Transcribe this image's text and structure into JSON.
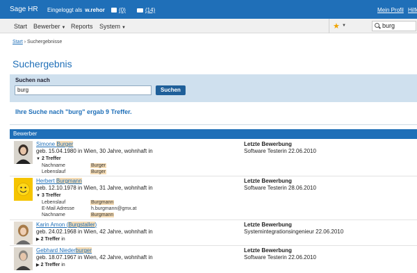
{
  "topbar": {
    "brand": "Sage HR",
    "logged_in_label": "Eingeloggt als",
    "user": "w.rehor",
    "tasks_label": "(0)",
    "messages_label": "(14)",
    "profile_link": "Mein Profil",
    "help_link": "Hilfe"
  },
  "nav": {
    "items": [
      "Start",
      "Bewerber",
      "Reports",
      "System"
    ],
    "search_value": "burg"
  },
  "breadcrumb": {
    "home": "Start",
    "separator": "›",
    "current": "Suchergebnisse"
  },
  "page_title": "Suchergebnis",
  "search": {
    "label": "Suchen nach",
    "value": "burg",
    "button": "Suchen"
  },
  "result_summary": "Ihre Suche nach \"burg\" ergab 9 Treffer.",
  "section_title": "Bewerber",
  "results": [
    {
      "name_pre": "Simone ",
      "name_hl": "Burger",
      "name_post": "",
      "info": "geb. 15.04.1980 in Wien, 30 Jahre, wohnhaft in",
      "hits": "2 Treffer",
      "hits_suffix": "",
      "fields": [
        {
          "label": "Nachname",
          "value": "Burger"
        },
        {
          "label": "Lebenslauf",
          "value": "Burger"
        }
      ],
      "last_label": "Letzte Bewerbung",
      "last_value": "Software Testerin 22.06.2010"
    },
    {
      "name_pre": "Herbert ",
      "name_hl": "Burgmann",
      "name_post": "",
      "info": "geb. 12.10.1978 in Wien, 31 Jahre, wohnhaft in",
      "hits": "3 Treffer",
      "hits_suffix": "",
      "fields": [
        {
          "label": "Lebenslauf",
          "value": "Burgmann"
        },
        {
          "label": "E-Mail Adresse",
          "value": "h.burgmann@gmx.at"
        },
        {
          "label": "Nachname",
          "value": "Burgmann"
        }
      ],
      "last_label": "Letzte Bewerbung",
      "last_value": "Software Testerin 28.06.2010"
    },
    {
      "name_pre": "Karin Amon (",
      "name_hl": "Burgstaller",
      "name_post": ")",
      "info": "geb. 24.02.1968 in Wien, 42 Jahre, wohnhaft in",
      "hits": "2 Treffer",
      "hits_suffix": " in",
      "fields": [],
      "last_label": "Letzte Bewerbung",
      "last_value": "Systemintegrationsingenieur 22.06.2010"
    },
    {
      "name_pre": "Gebhard Nieder",
      "name_hl": "burger",
      "name_post": "",
      "info": "geb. 18.07.1967 in Wien, 42 Jahre, wohnhaft in",
      "hits": "2 Treffer",
      "hits_suffix": " in",
      "fields": [],
      "last_label": "Letzte Bewerbung",
      "last_value": "Software Testerin 22.06.2010"
    }
  ]
}
